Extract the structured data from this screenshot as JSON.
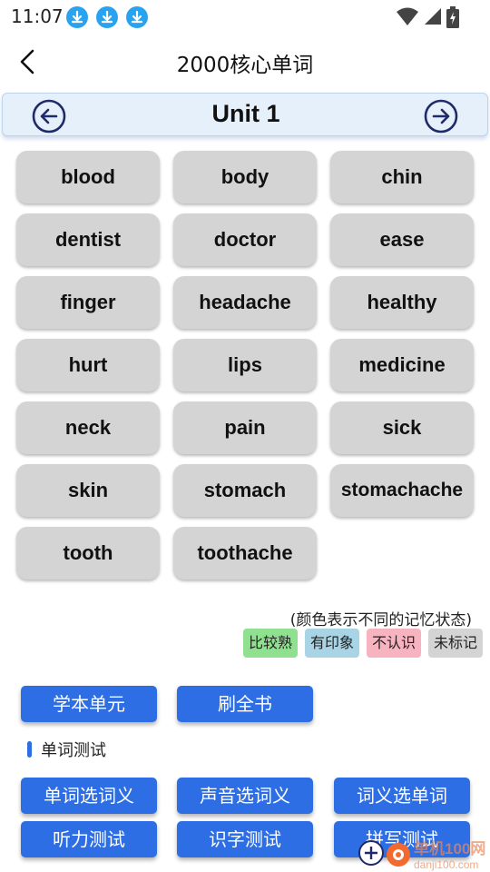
{
  "status_bar": {
    "time": "11:07",
    "icons": [
      "download-icon",
      "download-icon",
      "download-icon",
      "wifi-icon",
      "signal-icon",
      "battery-icon"
    ],
    "download_color": "#29a3f0"
  },
  "header": {
    "title": "2000核心单词",
    "back_icon": "chevron-left-icon"
  },
  "unit_bar": {
    "title": "Unit 1",
    "prev_icon": "arrow-left-circle-icon",
    "next_icon": "arrow-right-circle-icon",
    "accent": "#1f2a6b"
  },
  "words": [
    "blood",
    "body",
    "chin",
    "dentist",
    "doctor",
    "ease",
    "finger",
    "headache",
    "healthy",
    "hurt",
    "lips",
    "medicine",
    "neck",
    "pain",
    "sick",
    "skin",
    "stomach",
    "stomachache",
    "tooth",
    "toothache"
  ],
  "legend": {
    "note": "(颜色表示不同的记忆状态)",
    "items": [
      {
        "label": "比较熟",
        "color": "#8fe08f"
      },
      {
        "label": "有印象",
        "color": "#a8d4e6"
      },
      {
        "label": "不认识",
        "color": "#f7b3bf"
      },
      {
        "label": "未标记",
        "color": "#d4d4d4"
      }
    ]
  },
  "study": {
    "learn_unit": "学本单元",
    "review_book": "刷全书"
  },
  "test_section": {
    "label": "单词测试",
    "buttons": [
      "单词选词义",
      "声音选词义",
      "词义选单词",
      "听力测试",
      "识字测试",
      "拼写测试"
    ]
  },
  "watermark": {
    "line1": "单机100网",
    "line2": "danji100.com"
  },
  "colors": {
    "primary_button": "#2e6ee4",
    "card": "#d4d4d4",
    "unit_bar_bg": "#e6f0fb"
  }
}
